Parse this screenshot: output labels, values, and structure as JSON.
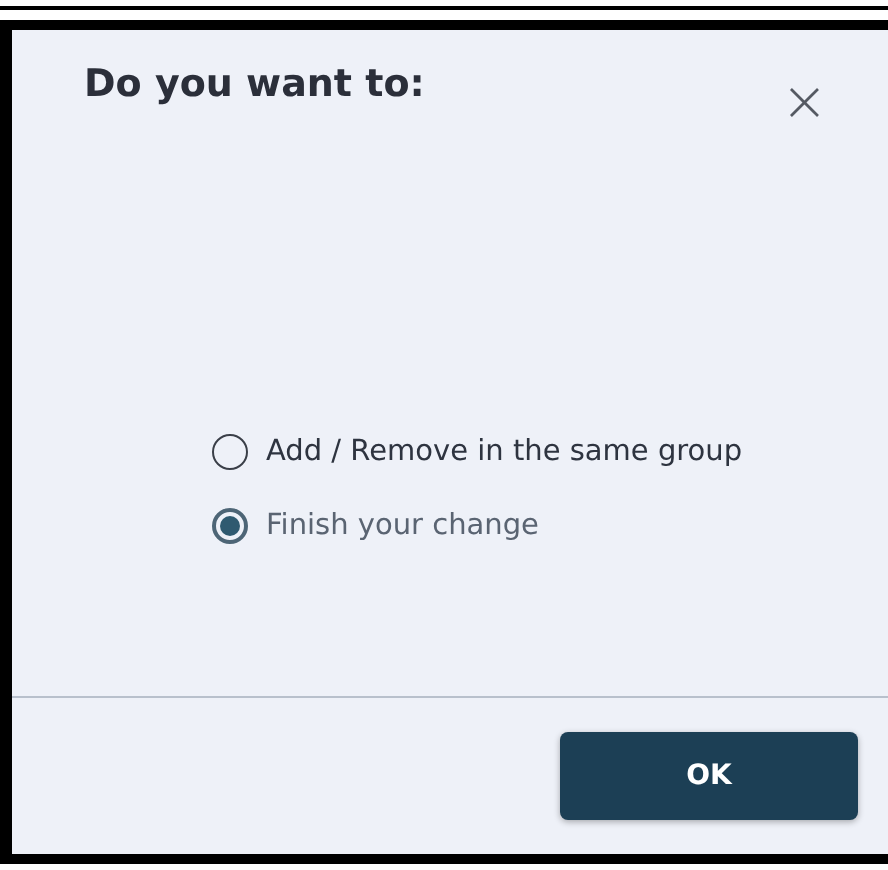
{
  "dialog": {
    "title": "Do you want to:",
    "close": "×",
    "options": [
      {
        "label": "Add / Remove in the same group",
        "selected": false
      },
      {
        "label": "Finish your change",
        "selected": true
      }
    ],
    "buttons": [
      "OK"
    ]
  }
}
